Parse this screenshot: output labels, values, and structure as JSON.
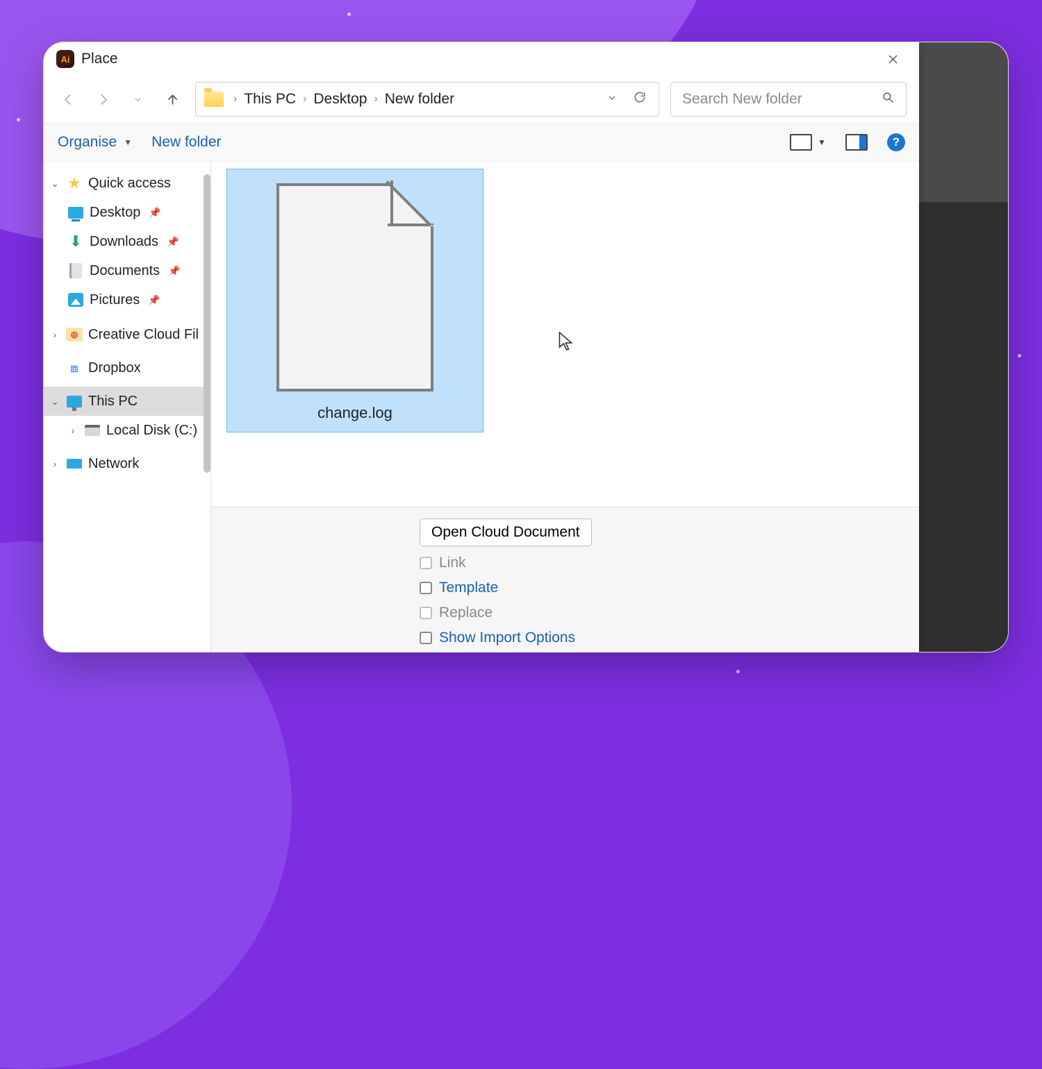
{
  "window": {
    "title": "Place",
    "ai_badge": "Ai"
  },
  "nav": {
    "breadcrumb": [
      "This PC",
      "Desktop",
      "New folder"
    ],
    "search_placeholder": "Search New folder"
  },
  "toolbar": {
    "organise": "Organise",
    "new_folder": "New folder"
  },
  "sidebar": {
    "quick_access": "Quick access",
    "items_pinned": [
      "Desktop",
      "Downloads",
      "Documents",
      "Pictures"
    ],
    "creative_cloud": "Creative Cloud Fil",
    "dropbox": "Dropbox",
    "this_pc": "This PC",
    "local_disk": "Local Disk (C:)",
    "network": "Network"
  },
  "files": {
    "selected": {
      "name": "change.log"
    }
  },
  "options": {
    "open_cloud": "Open Cloud Document",
    "link": "Link",
    "template": "Template",
    "replace": "Replace",
    "show_import": "Show Import Options"
  }
}
